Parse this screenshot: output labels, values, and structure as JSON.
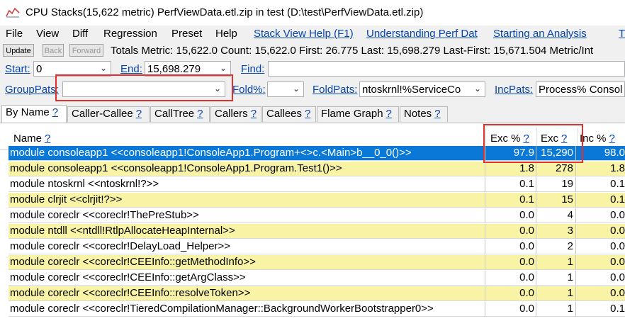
{
  "window": {
    "title": "CPU Stacks(15,622 metric) PerfViewData.etl.zip in test (D:\\test\\PerfViewData.etl.zip)",
    "icon": "chart-icon"
  },
  "menu": {
    "items": [
      "File",
      "View",
      "Diff",
      "Regression",
      "Preset",
      "Help"
    ],
    "links": [
      "Stack View Help (F1)",
      "Understanding Perf Dat",
      "Starting an Analysis",
      "T"
    ]
  },
  "toolbar": {
    "update": "Update",
    "back": "Back",
    "forward": "Forward",
    "totals": "Totals Metric: 15,622.0  Count: 15,622.0  First: 26.775  Last: 15,698.279  Last-First: 15,671.504  Metric/Int"
  },
  "filters": {
    "start_label": "Start:",
    "start_value": "0",
    "end_label": "End:",
    "end_value": "15,698.279",
    "find_label": "Find:",
    "find_value": "",
    "grouppats_label": "GroupPats:",
    "grouppats_value": "",
    "fold_label": "Fold%:",
    "fold_value": "",
    "foldpats_label": "FoldPats:",
    "foldpats_value": "ntoskrnl!%ServiceCo",
    "incpats_label": "IncPats:",
    "incpats_value": "Process% Consol"
  },
  "tabs": [
    {
      "label": "By Name",
      "q": "?"
    },
    {
      "label": "Caller-Callee",
      "q": "?"
    },
    {
      "label": "CallTree",
      "q": "?"
    },
    {
      "label": "Callers",
      "q": "?"
    },
    {
      "label": "Callees",
      "q": "?"
    },
    {
      "label": "Flame Graph",
      "q": "?"
    },
    {
      "label": "Notes",
      "q": "?"
    }
  ],
  "grid": {
    "headers": {
      "name": "Name",
      "exc_pct": "Exc %",
      "exc": "Exc",
      "inc_pct": "Inc %",
      "q": "?"
    },
    "rows": [
      {
        "name": "module consoleapp1 <<consoleapp1!ConsoleApp1.Program+<>c.<Main>b__0_0()>>",
        "exc_pct": "97.9",
        "exc": "15,290",
        "inc_pct": "98.0",
        "style": "selected"
      },
      {
        "name": "module consoleapp1 <<consoleapp1!ConsoleApp1.Program.Test1()>>",
        "exc_pct": "1.8",
        "exc": "278",
        "inc_pct": "1.8",
        "style": "yellow"
      },
      {
        "name": "module ntoskrnl <<ntoskrnl!?>>",
        "exc_pct": "0.1",
        "exc": "19",
        "inc_pct": "0.1",
        "style": "white"
      },
      {
        "name": "module clrjit <<clrjit!?>>",
        "exc_pct": "0.1",
        "exc": "15",
        "inc_pct": "0.1",
        "style": "yellow"
      },
      {
        "name": "module coreclr <<coreclr!ThePreStub>>",
        "exc_pct": "0.0",
        "exc": "4",
        "inc_pct": "0.0",
        "style": "white"
      },
      {
        "name": "module ntdll <<ntdll!RtlpAllocateHeapInternal>>",
        "exc_pct": "0.0",
        "exc": "3",
        "inc_pct": "0.0",
        "style": "yellow"
      },
      {
        "name": "module coreclr <<coreclr!DelayLoad_Helper>>",
        "exc_pct": "0.0",
        "exc": "2",
        "inc_pct": "0.0",
        "style": "white"
      },
      {
        "name": "module coreclr <<coreclr!CEEInfo::getMethodInfo>>",
        "exc_pct": "0.0",
        "exc": "1",
        "inc_pct": "0.0",
        "style": "yellow"
      },
      {
        "name": "module coreclr <<coreclr!CEEInfo::getArgClass>>",
        "exc_pct": "0.0",
        "exc": "1",
        "inc_pct": "0.0",
        "style": "white"
      },
      {
        "name": "module coreclr <<coreclr!CEEInfo::resolveToken>>",
        "exc_pct": "0.0",
        "exc": "1",
        "inc_pct": "0.0",
        "style": "yellow"
      },
      {
        "name": "module coreclr <<coreclr!TieredCompilationManager::BackgroundWorkerBootstrapper0>>",
        "exc_pct": "0.0",
        "exc": "1",
        "inc_pct": "0.1",
        "style": "white"
      }
    ]
  },
  "colors": {
    "highlight_box": "#e03030",
    "selected_row": "#0a78d7",
    "yellow_row": "#f8f3a5",
    "link": "#0645ad"
  }
}
